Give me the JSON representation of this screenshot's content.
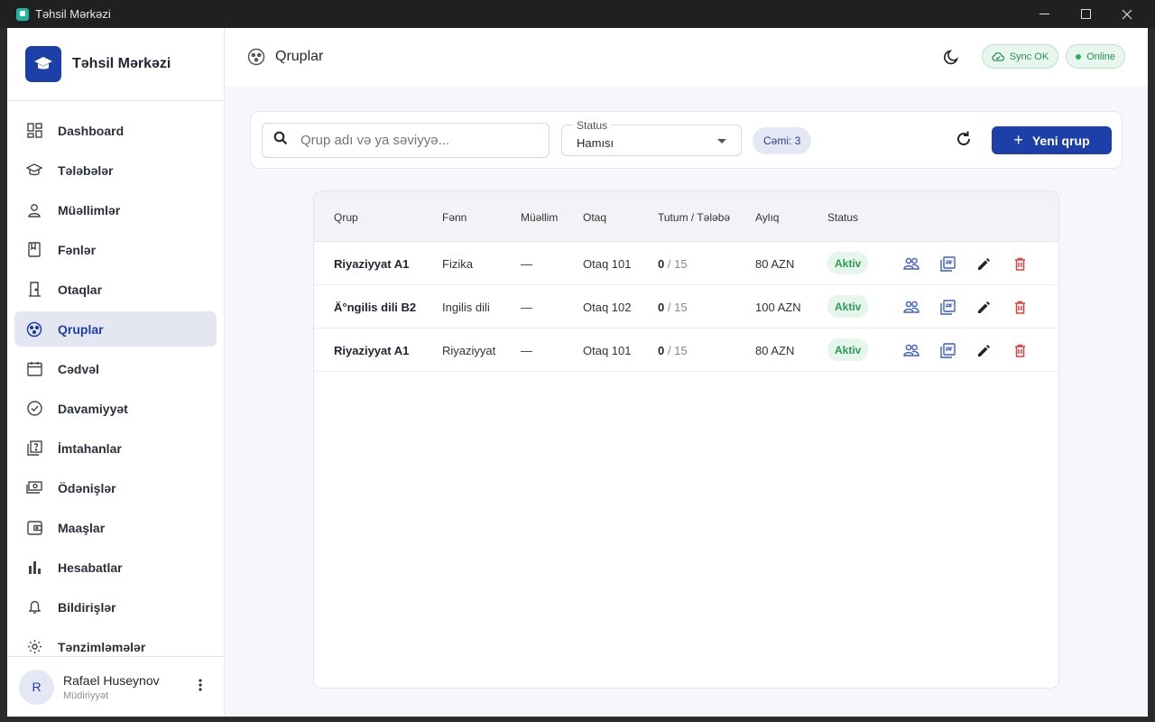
{
  "window": {
    "title": "Təhsil Mərkəzi"
  },
  "brand": {
    "name": "Təhsil Mərkəzi"
  },
  "nav": [
    {
      "label": "Dashboard",
      "icon": "dashboard-icon"
    },
    {
      "label": "Tələbələr",
      "icon": "school-icon"
    },
    {
      "label": "Müəllimlər",
      "icon": "person-icon"
    },
    {
      "label": "Fənlər",
      "icon": "book-icon"
    },
    {
      "label": "Otaqlar",
      "icon": "door-icon"
    },
    {
      "label": "Qruplar",
      "icon": "groups-icon"
    },
    {
      "label": "Cədvəl",
      "icon": "calendar-icon"
    },
    {
      "label": "Davamiyyət",
      "icon": "check-circle-icon"
    },
    {
      "label": "İmtahanlar",
      "icon": "quiz-icon"
    },
    {
      "label": "Ödənişlər",
      "icon": "payments-icon"
    },
    {
      "label": "Maaşlar",
      "icon": "wallet-icon"
    },
    {
      "label": "Hesabatlar",
      "icon": "bar-chart-icon"
    },
    {
      "label": "Bildirişlər",
      "icon": "bell-icon"
    },
    {
      "label": "Tənzimləmələr",
      "icon": "gear-icon"
    }
  ],
  "active_nav": "Qruplar",
  "user": {
    "initial": "R",
    "name": "Rafael Huseynov",
    "role": "Müdiriyyət"
  },
  "header": {
    "title": "Qruplar",
    "sync": "Sync OK",
    "online": "Online"
  },
  "toolbar": {
    "search_placeholder": "Qrup adı və ya səviyyə...",
    "status_label": "Status",
    "status_value": "Hamısı",
    "count": "Cəmi: 3",
    "new_button": "Yeni qrup"
  },
  "table": {
    "columns": [
      "Qrup",
      "Fənn",
      "Müəllim",
      "Otaq",
      "Tutum / Tələbə",
      "Aylıq",
      "Status"
    ],
    "rows": [
      {
        "group": "Riyaziyyat A1",
        "subject": "Fizika",
        "teacher": "—",
        "room": "Otaq 101",
        "enrolled": "0",
        "capacity": "/ 15",
        "monthly": "80 AZN",
        "status": "Aktiv"
      },
      {
        "group": "Ä°ngilis dili B2",
        "subject": "Ingilis dili",
        "teacher": "—",
        "room": "Otaq 102",
        "enrolled": "0",
        "capacity": "/ 15",
        "monthly": "100 AZN",
        "status": "Aktiv"
      },
      {
        "group": "Riyaziyyat A1",
        "subject": "Riyaziyyat",
        "teacher": "—",
        "room": "Otaq 101",
        "enrolled": "0",
        "capacity": "/ 15",
        "monthly": "80 AZN",
        "status": "Aktiv"
      }
    ]
  },
  "colors": {
    "primary": "#1d3fa8",
    "success": "#2c9a55",
    "danger": "#e0403a",
    "link": "#3a5fc8"
  }
}
